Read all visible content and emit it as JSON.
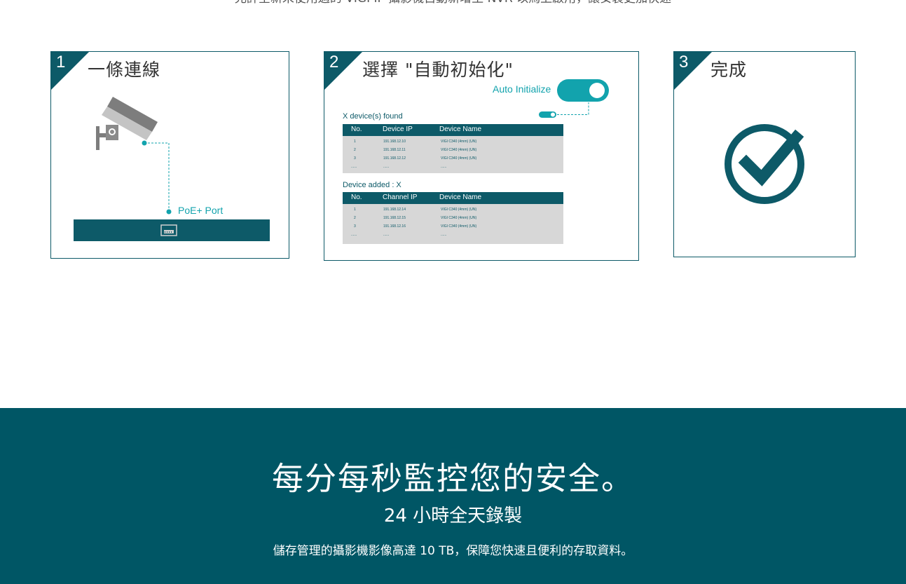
{
  "intro_text": "允許全新未使用過的 VIGI IP 攝影機自動新增至 NVR 以馬上啟用，讓安裝更加快速",
  "steps": [
    {
      "number": "1",
      "title": "一條連線",
      "poe_label": "PoE+ Port"
    },
    {
      "number": "2",
      "title": "選擇 \"自動初始化\"",
      "toggle_label": "Auto Initialize",
      "found": {
        "label": "X device(s) found",
        "headers": [
          "No.",
          "Device IP",
          "Device Name"
        ],
        "rows": [
          [
            "1",
            "191.168.12.10",
            "VIGI C340 (4mm) (UN)"
          ],
          [
            "2",
            "191.168.12.11",
            "VIGI C340 (4mm) (UN)"
          ],
          [
            "3",
            "191.168.12.12",
            "VIGI C340 (4mm) (UN)"
          ],
          [
            "......",
            "......",
            "......"
          ]
        ]
      },
      "added": {
        "label": "Device added : X",
        "headers": [
          "No.",
          "Channel IP",
          "Device Name"
        ],
        "rows": [
          [
            "1",
            "191.168.12.14",
            "VIGI C340 (4mm) (UN)"
          ],
          [
            "2",
            "191.168.12.15",
            "VIGI C340 (4mm) (UN)"
          ],
          [
            "3",
            "191.168.12.16",
            "VIGI C340 (4mm) (UN)"
          ],
          [
            "......",
            "......",
            "......"
          ]
        ]
      }
    },
    {
      "number": "3",
      "title": "完成"
    }
  ],
  "feature": {
    "headline": "每分每秒監控您的安全。",
    "subheadline": "24 小時全天錄製",
    "description": "儲存管理的攝影機影像高達 10 TB，保障您快速且便利的存取資料。"
  },
  "colors": {
    "primary": "#0d5a68",
    "accent": "#12a3ad",
    "band": "#005665",
    "table_bg": "#d7d7d7"
  },
  "icons": [
    "camera-icon",
    "ethernet-port-icon",
    "toggle-icon",
    "check-circle-icon"
  ]
}
